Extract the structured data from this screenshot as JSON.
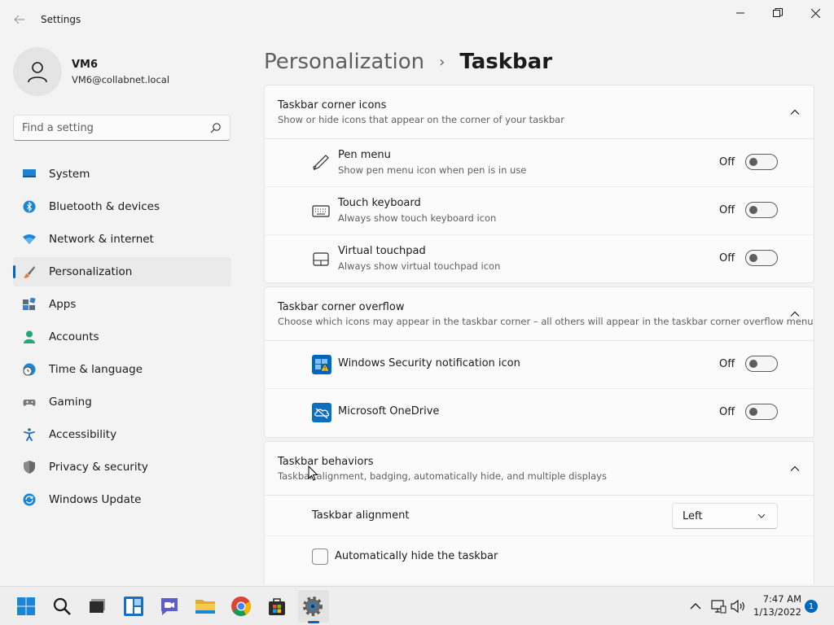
{
  "window": {
    "title": "Settings",
    "back_icon": "back-arrow-icon",
    "controls": [
      "minimize-icon",
      "maximize-icon",
      "close-icon"
    ]
  },
  "profile": {
    "name": "VM6",
    "email": "VM6@collabnet.local"
  },
  "search": {
    "placeholder": "Find a setting"
  },
  "sidebar": {
    "items": [
      {
        "label": "System",
        "icon": "monitor-icon",
        "active": false
      },
      {
        "label": "Bluetooth & devices",
        "icon": "bluetooth-icon",
        "active": false
      },
      {
        "label": "Network & internet",
        "icon": "wifi-icon",
        "active": false
      },
      {
        "label": "Personalization",
        "icon": "paintbrush-icon",
        "active": true
      },
      {
        "label": "Apps",
        "icon": "apps-icon",
        "active": false
      },
      {
        "label": "Accounts",
        "icon": "person-icon",
        "active": false
      },
      {
        "label": "Time & language",
        "icon": "globe-clock-icon",
        "active": false
      },
      {
        "label": "Gaming",
        "icon": "gamepad-icon",
        "active": false
      },
      {
        "label": "Accessibility",
        "icon": "accessibility-icon",
        "active": false
      },
      {
        "label": "Privacy & security",
        "icon": "shield-icon",
        "active": false
      },
      {
        "label": "Windows Update",
        "icon": "update-icon",
        "active": false
      }
    ]
  },
  "header": {
    "parent": "Personalization",
    "separator": "›",
    "current": "Taskbar"
  },
  "corner_icons": {
    "title": "Taskbar corner icons",
    "subtitle": "Show or hide icons that appear on the corner of your taskbar",
    "rows": [
      {
        "title": "Pen menu",
        "subtitle": "Show pen menu icon when pen is in use",
        "state": "Off",
        "icon": "pen-icon"
      },
      {
        "title": "Touch keyboard",
        "subtitle": "Always show touch keyboard icon",
        "state": "Off",
        "icon": "keyboard-icon"
      },
      {
        "title": "Virtual touchpad",
        "subtitle": "Always show virtual touchpad icon",
        "state": "Off",
        "icon": "touchpad-icon"
      }
    ]
  },
  "corner_overflow": {
    "title": "Taskbar corner overflow",
    "subtitle": "Choose which icons may appear in the taskbar corner – all others will appear in the taskbar corner overflow menu",
    "rows": [
      {
        "title": "Windows Security notification icon",
        "state": "Off",
        "icon": "windows-security-icon"
      },
      {
        "title": "Microsoft OneDrive",
        "state": "Off",
        "icon": "onedrive-icon"
      }
    ]
  },
  "behaviors": {
    "title": "Taskbar behaviors",
    "subtitle": "Taskbar alignment, badging, automatically hide, and multiple displays",
    "alignment_label": "Taskbar alignment",
    "alignment_value": "Left",
    "autohide_label": "Automatically hide the taskbar",
    "autohide_checked": false
  },
  "taskbar": {
    "apps": [
      "start-icon",
      "search-icon",
      "task-view-icon",
      "widgets-icon",
      "chat-icon",
      "file-explorer-icon",
      "chrome-icon",
      "store-icon",
      "settings-icon"
    ],
    "tray": [
      "chevron-up-icon",
      "network-icon",
      "volume-icon"
    ],
    "time": "7:47 AM",
    "date": "1/13/2022",
    "notification_count": "1"
  },
  "colors": {
    "accent": "#0067c0",
    "background": "#f3f3f3",
    "card": "#fbfbfb"
  }
}
